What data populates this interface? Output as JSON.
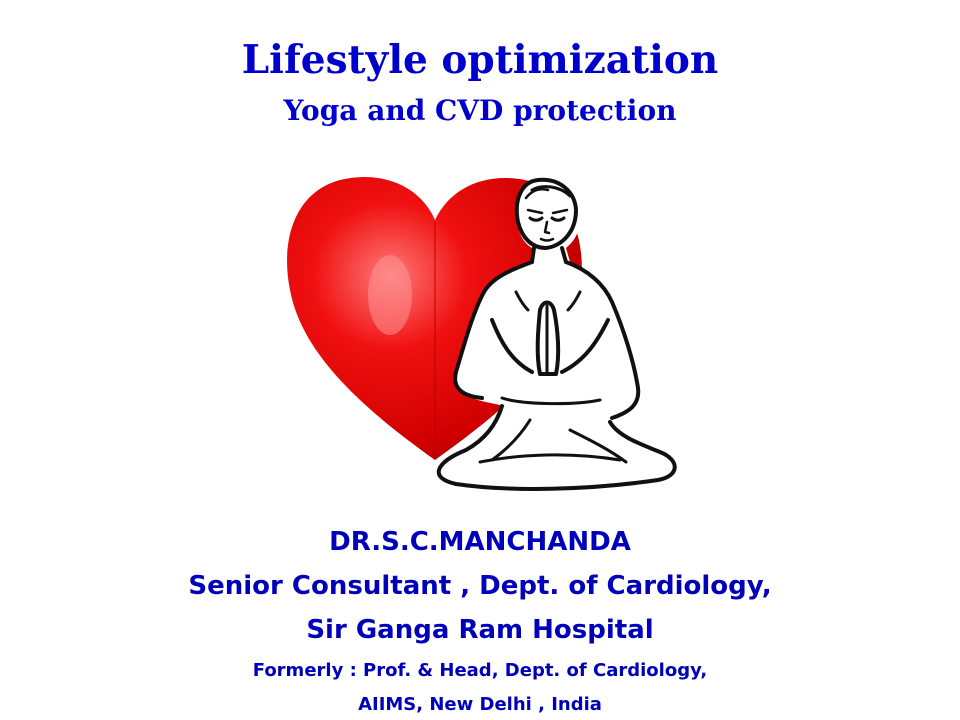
{
  "slide": {
    "title": "Lifestyle optimization",
    "subtitle": "Yoga and CVD protection"
  },
  "credits": {
    "name": "DR.S.C.MANCHANDA",
    "role": "Senior Consultant , Dept. of Cardiology,",
    "hospital": "Sir Ganga Ram Hospital",
    "formerly": "Formerly : Prof. & Head, Dept. of Cardiology,",
    "place": "AIIMS, New Delhi , India"
  },
  "illustration": {
    "icons": [
      "heart-icon",
      "meditating-figure-icon"
    ],
    "colors": {
      "heart": "#e10000",
      "heart_highlight": "#ff6a6a",
      "heart_shadow": "#a80000",
      "outline": "#111111",
      "text": "#0000cc"
    }
  }
}
